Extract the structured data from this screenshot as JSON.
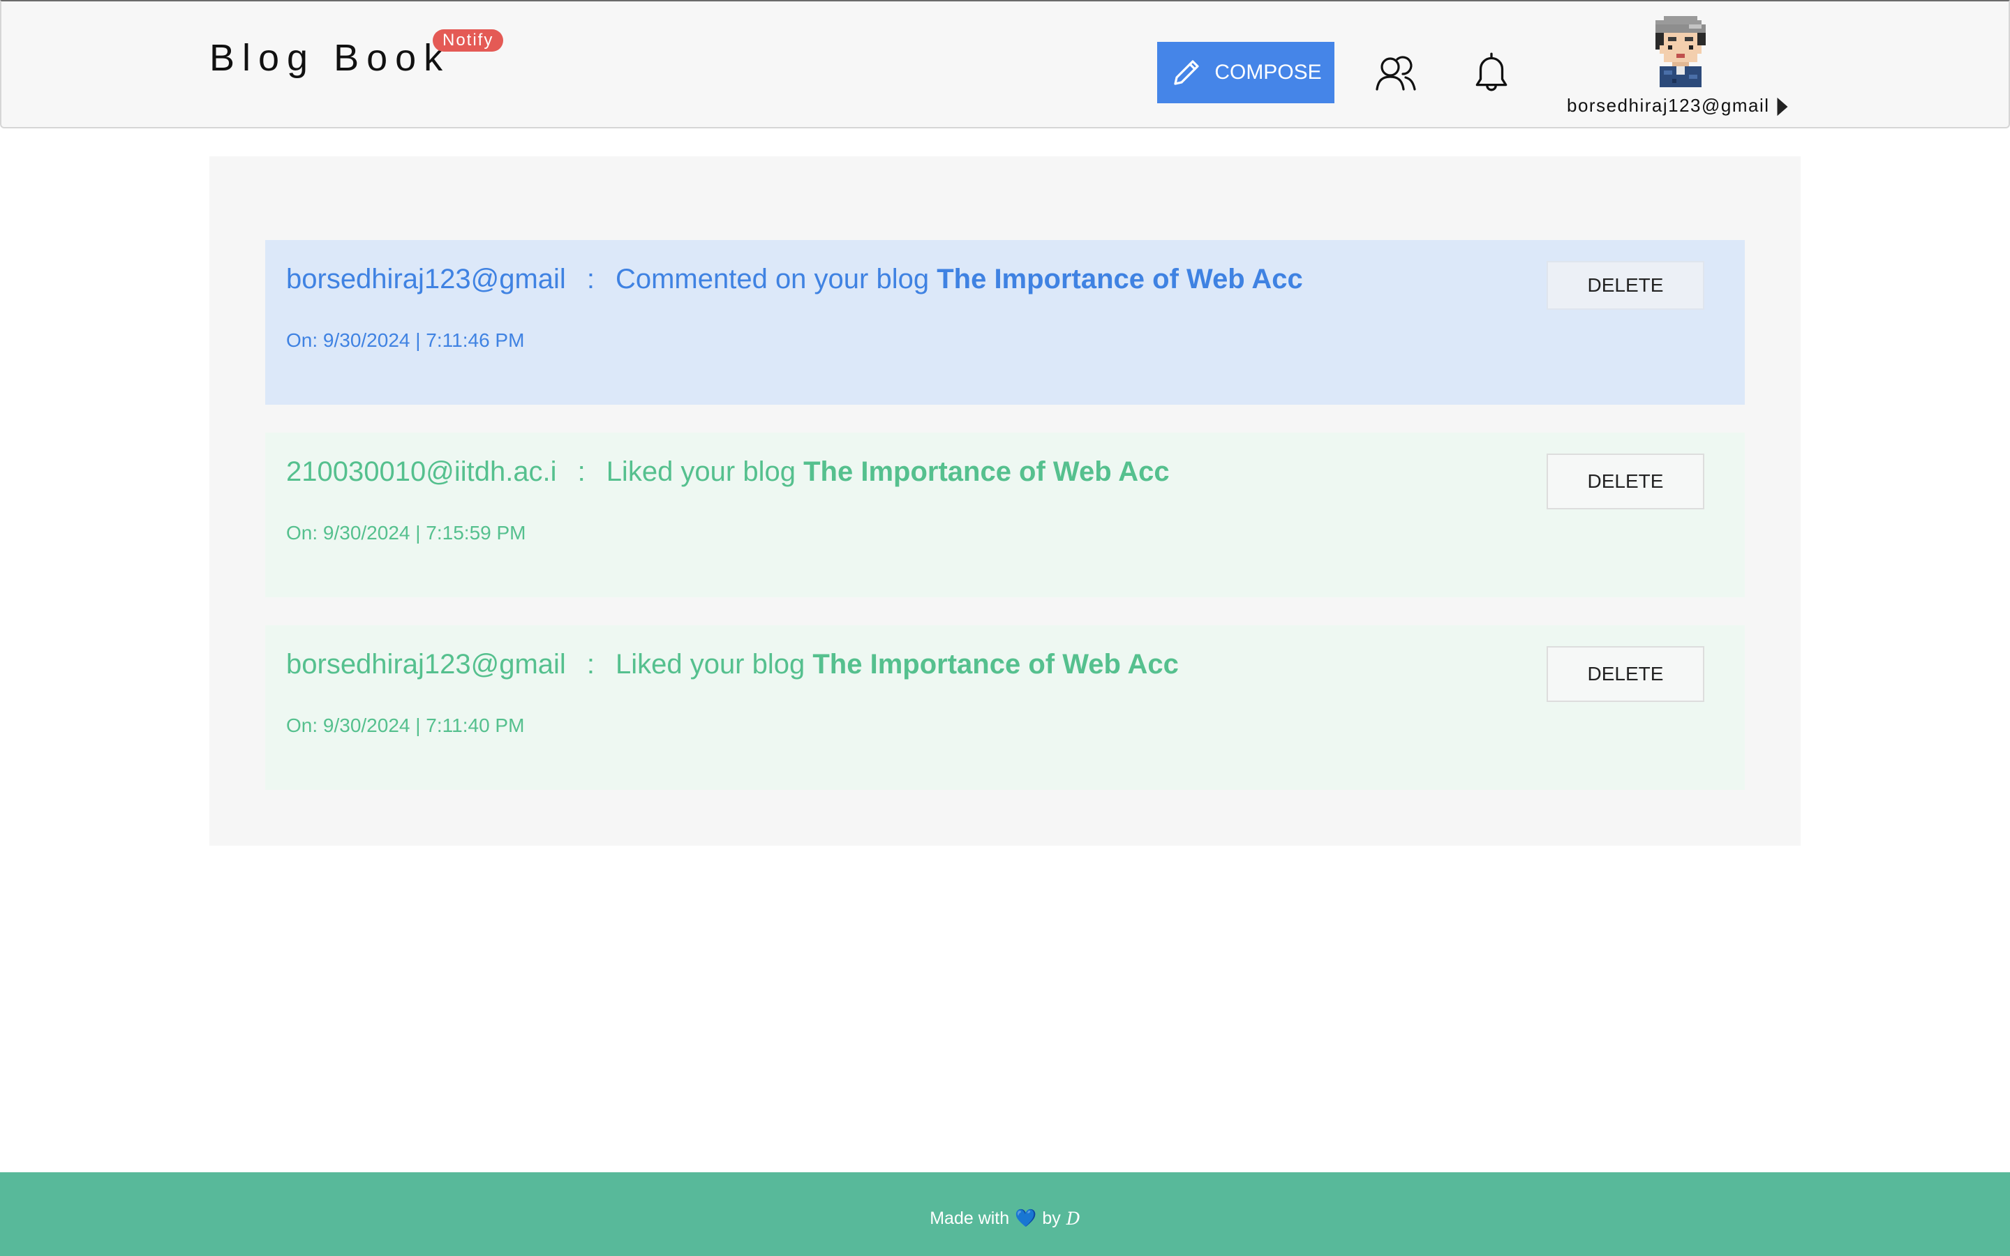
{
  "header": {
    "brand_title": "Blog Book",
    "brand_badge": "Notify",
    "compose_label": "COMPOSE",
    "user_email": "borsedhiraj123@gmail"
  },
  "notifications": [
    {
      "user": "borsedhiraj123@gmail",
      "separator": ":",
      "action": "Commented on your blog",
      "blog_title": "The Importance of Web Acc",
      "time": "On: 9/30/2024 | 7:11:46 PM",
      "delete_label": "DELETE",
      "kind": "comment"
    },
    {
      "user": "210030010@iitdh.ac.i",
      "separator": ":",
      "action": "Liked your blog",
      "blog_title": "The Importance of Web Acc",
      "time": "On: 9/30/2024 | 7:15:59 PM",
      "delete_label": "DELETE",
      "kind": "like"
    },
    {
      "user": "borsedhiraj123@gmail",
      "separator": ":",
      "action": "Liked your blog",
      "blog_title": "The Importance of Web Acc",
      "time": "On: 9/30/2024 | 7:11:40 PM",
      "delete_label": "DELETE",
      "kind": "like"
    }
  ],
  "footer": {
    "made_with": "Made with",
    "heart": "💙",
    "by": "by",
    "signature": "D"
  },
  "colors": {
    "compose_bg": "#4585e8",
    "comment_text": "#3f82e2",
    "comment_bg": "#dce8f9",
    "like_text": "#55c08e",
    "like_bg": "#eef8f2",
    "footer_bg": "#58b99a",
    "badge_bg": "#e45a55"
  },
  "icons": {
    "compose": "pencil-icon",
    "friends": "users-icon",
    "notifications": "bell-icon",
    "account_menu": "caret-right-icon"
  }
}
